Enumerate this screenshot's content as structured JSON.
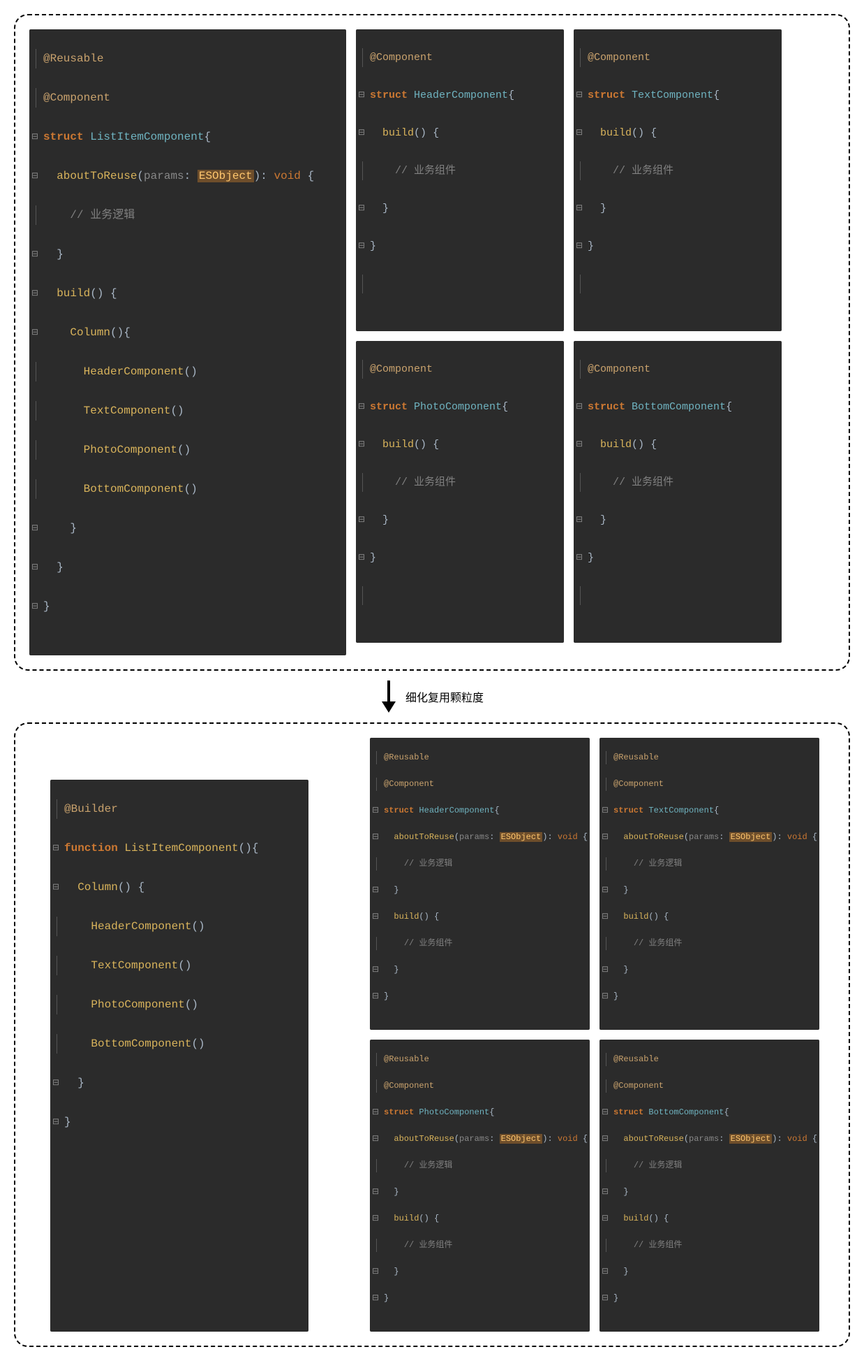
{
  "arrow_label": "细化复用颗粒度",
  "tokens": {
    "reusable": "@Reusable",
    "component": "@Component",
    "builder": "@Builder",
    "struct": "struct",
    "function": "function",
    "aboutToReuse": "aboutToReuse",
    "params": "params",
    "esobject": "ESObject",
    "void": "void",
    "build": "build",
    "column": "Column",
    "comment_logic": "// 业务逻辑",
    "comment_comp": "// 业务组件"
  },
  "names": {
    "ListItemComponent": "ListItemComponent",
    "HeaderComponent": "HeaderComponent",
    "TextComponent": "TextComponent",
    "PhotoComponent": "PhotoComponent",
    "BottomComponent": "BottomComponent"
  },
  "top": {
    "main": {
      "struct_name": "ListItemComponent",
      "children": [
        "HeaderComponent",
        "TextComponent",
        "PhotoComponent",
        "BottomComponent"
      ]
    },
    "side": [
      "HeaderComponent",
      "TextComponent",
      "PhotoComponent",
      "BottomComponent"
    ]
  },
  "bottom": {
    "main": {
      "func_name": "ListItemComponent",
      "children": [
        "HeaderComponent",
        "TextComponent",
        "PhotoComponent",
        "BottomComponent"
      ]
    },
    "side": [
      "HeaderComponent",
      "TextComponent",
      "PhotoComponent",
      "BottomComponent"
    ]
  }
}
